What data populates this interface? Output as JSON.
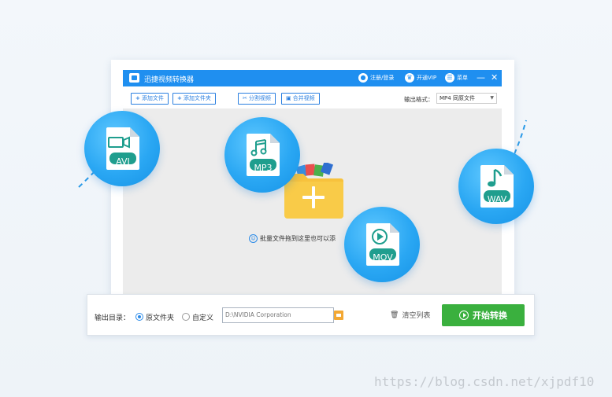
{
  "window": {
    "title": "迅捷视频转换器",
    "register_label": "注册/登录",
    "vip_label": "开通VIP",
    "menu_label": "菜单",
    "minimize_glyph": "—",
    "close_glyph": "✕"
  },
  "toolbar": {
    "add_file_label": "添加文件",
    "add_folder_label": "添加文件夹",
    "split_video_label": "分割视频",
    "merge_video_label": "合并视频",
    "output_format_label": "输出格式：",
    "output_format_value": "MP4  同原文件"
  },
  "content": {
    "drop_hint": "批量文件拖到这里也可以添"
  },
  "bottom": {
    "output_dir_label": "输出目录：",
    "option_original": "原文件夹",
    "option_custom": "自定义",
    "path_value": "D:\\NVIDIA Corporation",
    "clear_list_label": "清空列表",
    "start_label": "开始转换"
  },
  "formats": {
    "avi": "AVI",
    "mp3": "MP3",
    "mov": "MOV",
    "wav": "WAV"
  },
  "watermark": "https://blog.csdn.net/xjpdf10",
  "colors": {
    "brand_blue": "#1f8ff0",
    "start_green": "#3ab03e",
    "badge_teal": "#1f9e8e"
  }
}
